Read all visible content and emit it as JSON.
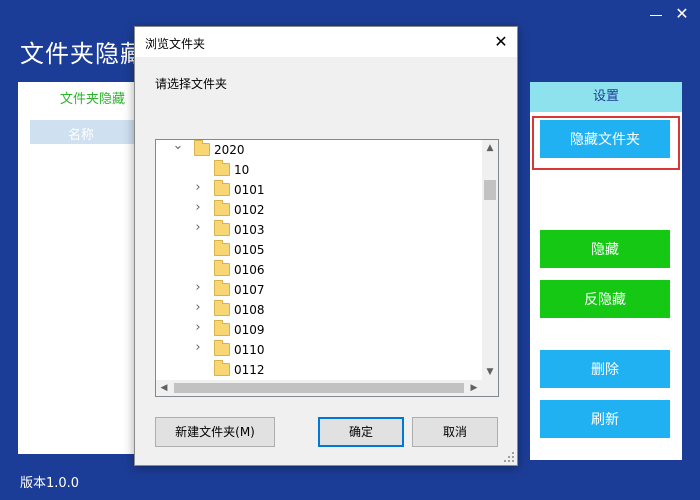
{
  "app": {
    "title": "文件夹隐藏",
    "version": "版本1.0.0",
    "left_tab": "文件夹隐藏",
    "list_header": "名称",
    "close_glyph": "✕",
    "settings_tab": "设置",
    "buttons": {
      "hide_folder": "隐藏文件夹",
      "hide": "隐藏",
      "unhide": "反隐藏",
      "delete": "删除",
      "refresh": "刷新"
    }
  },
  "dialog": {
    "title": "浏览文件夹",
    "close_glyph": "✕",
    "prompt": "请选择文件夹",
    "tree": [
      {
        "label": "2020",
        "expanded": true,
        "has_children": true,
        "level": 0
      },
      {
        "label": "10",
        "has_children": false,
        "level": 1
      },
      {
        "label": "0101",
        "has_children": true,
        "level": 1
      },
      {
        "label": "0102",
        "has_children": true,
        "level": 1
      },
      {
        "label": "0103",
        "has_children": true,
        "level": 1
      },
      {
        "label": "0105",
        "has_children": false,
        "level": 1
      },
      {
        "label": "0106",
        "has_children": false,
        "level": 1
      },
      {
        "label": "0107",
        "has_children": true,
        "level": 1
      },
      {
        "label": "0108",
        "has_children": true,
        "level": 1
      },
      {
        "label": "0109",
        "has_children": true,
        "level": 1
      },
      {
        "label": "0110",
        "has_children": true,
        "level": 1
      },
      {
        "label": "0112",
        "has_children": false,
        "level": 1
      }
    ],
    "buttons": {
      "new_folder": "新建文件夹(M)",
      "ok": "确定",
      "cancel": "取消"
    }
  },
  "colors": {
    "app_background": "#1c3d97",
    "accent_blue": "#1fb1f2",
    "accent_green": "#14c814",
    "highlight_red": "#d93636",
    "settings_tab": "#8ee2ee"
  }
}
